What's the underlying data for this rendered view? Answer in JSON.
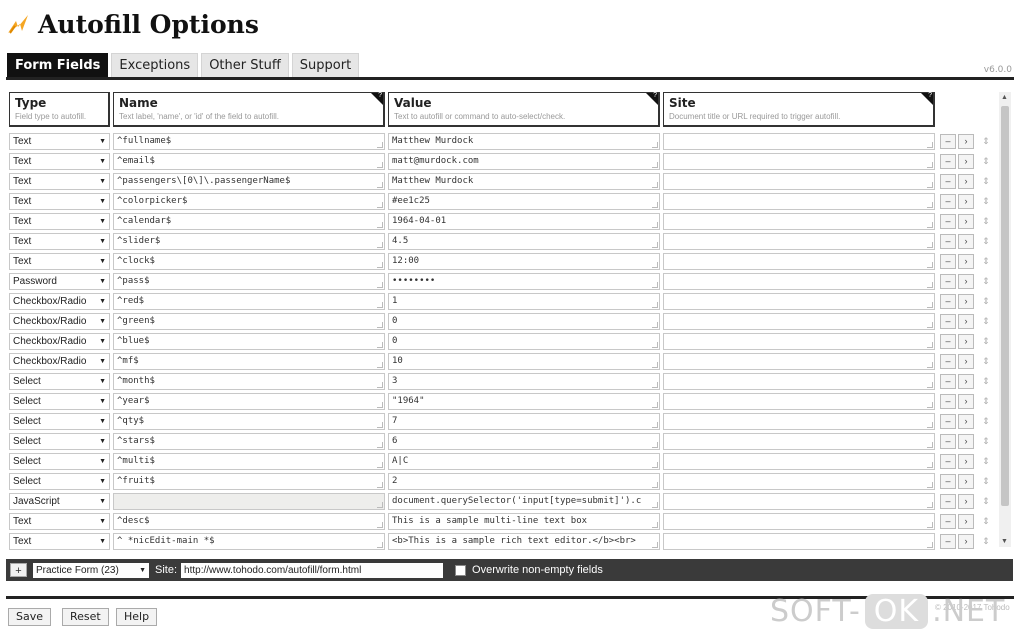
{
  "app": {
    "title": "Autofill Options",
    "version": "v6.0.0"
  },
  "tabs": [
    {
      "label": "Form Fields",
      "active": true
    },
    {
      "label": "Exceptions",
      "active": false
    },
    {
      "label": "Other Stuff",
      "active": false
    },
    {
      "label": "Support",
      "active": false
    }
  ],
  "columns": {
    "type": {
      "title": "Type",
      "desc": "Field type to autofill."
    },
    "name": {
      "title": "Name",
      "desc": "Text label, 'name', or 'id' of the field to autofill."
    },
    "value": {
      "title": "Value",
      "desc": "Text to autofill or command to auto-select/check."
    },
    "site": {
      "title": "Site",
      "desc": "Document title or URL required to trigger autofill."
    }
  },
  "rows": [
    {
      "type": "Text",
      "name": "^fullname$",
      "value": "Matthew Murdock",
      "site": ""
    },
    {
      "type": "Text",
      "name": "^email$",
      "value": "matt@murdock.com",
      "site": ""
    },
    {
      "type": "Text",
      "name": "^passengers\\[0\\]\\.passengerName$",
      "value": "Matthew Murdock",
      "site": ""
    },
    {
      "type": "Text",
      "name": "^colorpicker$",
      "value": "#ee1c25",
      "site": ""
    },
    {
      "type": "Text",
      "name": "^calendar$",
      "value": "1964-04-01",
      "site": ""
    },
    {
      "type": "Text",
      "name": "^slider$",
      "value": "4.5",
      "site": ""
    },
    {
      "type": "Text",
      "name": "^clock$",
      "value": "12:00",
      "site": ""
    },
    {
      "type": "Password",
      "name": "^pass$",
      "value": "••••••••",
      "site": ""
    },
    {
      "type": "Checkbox/Radio",
      "name": "^red$",
      "value": "1",
      "site": ""
    },
    {
      "type": "Checkbox/Radio",
      "name": "^green$",
      "value": "0",
      "site": ""
    },
    {
      "type": "Checkbox/Radio",
      "name": "^blue$",
      "value": "0",
      "site": ""
    },
    {
      "type": "Checkbox/Radio",
      "name": "^mf$",
      "value": "10",
      "site": ""
    },
    {
      "type": "Select",
      "name": "^month$",
      "value": "3",
      "site": ""
    },
    {
      "type": "Select",
      "name": "^year$",
      "value": "\"1964\"",
      "site": ""
    },
    {
      "type": "Select",
      "name": "^qty$",
      "value": "7",
      "site": ""
    },
    {
      "type": "Select",
      "name": "^stars$",
      "value": "6",
      "site": ""
    },
    {
      "type": "Select",
      "name": "^multi$",
      "value": "A|C",
      "site": ""
    },
    {
      "type": "Select",
      "name": "^fruit$",
      "value": "2",
      "site": ""
    },
    {
      "type": "JavaScript",
      "name": "",
      "value": "document.querySelector('input[type=submit]').c",
      "site": ""
    },
    {
      "type": "Text",
      "name": "^desc$",
      "value": "This is a sample multi-line text box",
      "site": ""
    },
    {
      "type": "Text",
      "name": "^ *nicEdit-main *$",
      "value": "<b>This is a sample rich text editor.</b><br>",
      "site": ""
    }
  ],
  "row_buttons": {
    "remove": "–",
    "move": "›",
    "drag": "⇕"
  },
  "bottom_bar": {
    "add_label": "+",
    "profile": "Practice Form (23)",
    "site_label": "Site:",
    "site_value": "http://www.tohodo.com/autofill/form.html",
    "overwrite_label": "Overwrite non-empty fields"
  },
  "buttons": {
    "save": "Save",
    "reset": "Reset",
    "help": "Help"
  },
  "footer": {
    "copyright": "© 2010-2017 Tohodo",
    "watermark_left": "SOFT-",
    "watermark_ok": "OK",
    "watermark_right": ".NET"
  },
  "colors": {
    "bar": "#3a3a3a",
    "tab_active": "#111111",
    "logo_accent": "#f5a623"
  }
}
